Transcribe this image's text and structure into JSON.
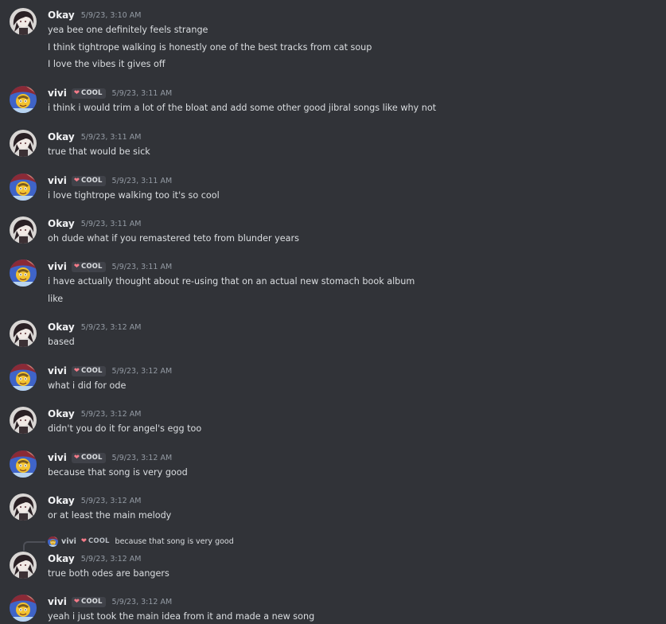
{
  "messages": [
    {
      "author": "Okay",
      "avatar": "okay-avatar",
      "timestamp": "5/9/23, 3:10 AM",
      "lines": [
        "yea bee one definitely feels strange",
        "I think tightrope walking is honestly one of the best tracks from cat soup",
        "I love the vibes it gives off"
      ]
    },
    {
      "author": "vivi",
      "avatar": "vivi-avatar",
      "badge": {
        "icon": "heart-icon",
        "text": "COOL"
      },
      "timestamp": "5/9/23, 3:11 AM",
      "lines": [
        "i think i would trim a lot of the bloat and add some other good jibral songs like why not"
      ]
    },
    {
      "author": "Okay",
      "avatar": "okay-avatar",
      "timestamp": "5/9/23, 3:11 AM",
      "lines": [
        "true that would be sick"
      ]
    },
    {
      "author": "vivi",
      "avatar": "vivi-avatar",
      "badge": {
        "icon": "heart-icon",
        "text": "COOL"
      },
      "timestamp": "5/9/23, 3:11 AM",
      "lines": [
        "i love tightrope walking too it's so cool"
      ]
    },
    {
      "author": "Okay",
      "avatar": "okay-avatar",
      "timestamp": "5/9/23, 3:11 AM",
      "lines": [
        "oh dude what if you remastered teto from blunder years"
      ]
    },
    {
      "author": "vivi",
      "avatar": "vivi-avatar",
      "badge": {
        "icon": "heart-icon",
        "text": "COOL"
      },
      "timestamp": "5/9/23, 3:11 AM",
      "lines": [
        "i have actually thought about re-using that on an actual new stomach book album",
        "like"
      ]
    },
    {
      "author": "Okay",
      "avatar": "okay-avatar",
      "timestamp": "5/9/23, 3:12 AM",
      "lines": [
        "based"
      ]
    },
    {
      "author": "vivi",
      "avatar": "vivi-avatar",
      "badge": {
        "icon": "heart-icon",
        "text": "COOL"
      },
      "timestamp": "5/9/23, 3:12 AM",
      "lines": [
        "what i did for ode"
      ]
    },
    {
      "author": "Okay",
      "avatar": "okay-avatar",
      "timestamp": "5/9/23, 3:12 AM",
      "lines": [
        "didn't you do it for angel's egg too"
      ]
    },
    {
      "author": "vivi",
      "avatar": "vivi-avatar",
      "badge": {
        "icon": "heart-icon",
        "text": "COOL"
      },
      "timestamp": "5/9/23, 3:12 AM",
      "lines": [
        "because that song is very good"
      ]
    },
    {
      "author": "Okay",
      "avatar": "okay-avatar",
      "timestamp": "5/9/23, 3:12 AM",
      "lines": [
        "or at least the main melody"
      ]
    },
    {
      "author": "Okay",
      "avatar": "okay-avatar",
      "timestamp": "5/9/23, 3:12 AM",
      "reply": {
        "author": "vivi",
        "badge": {
          "icon": "heart-icon",
          "text": "COOL"
        },
        "text": "because that song is very good"
      },
      "lines": [
        "true both odes are bangers"
      ]
    },
    {
      "author": "vivi",
      "avatar": "vivi-avatar",
      "badge": {
        "icon": "heart-icon",
        "text": "COOL"
      },
      "timestamp": "5/9/23, 3:12 AM",
      "lines": [
        "yeah i just took the main idea from it and made a new song"
      ]
    }
  ],
  "colors": {
    "background": "#313338",
    "username": "#f2f3f5",
    "message_text": "#dbdee1",
    "timestamp": "#949ba4",
    "badge_heart": "#f47b89"
  }
}
